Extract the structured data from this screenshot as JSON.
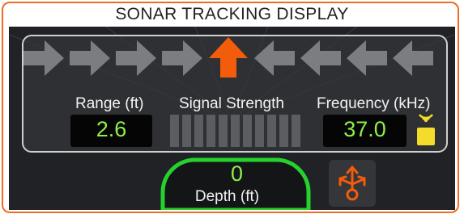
{
  "title": "SONAR TRACKING DISPLAY",
  "colors": {
    "frame": "#ef6c22",
    "accent": "#f25c0a",
    "arrow_inactive": "#7b7d80",
    "value_text": "#8df04a",
    "depth_ring": "#25d12d",
    "signal_icon": "#f5dc2a",
    "signal_bar_off": "#5b5d61"
  },
  "direction_arrows": {
    "items": [
      {
        "direction": "right",
        "active": false
      },
      {
        "direction": "right",
        "active": false
      },
      {
        "direction": "right",
        "active": false
      },
      {
        "direction": "right",
        "active": false
      },
      {
        "direction": "up",
        "active": true
      },
      {
        "direction": "left",
        "active": false
      },
      {
        "direction": "left",
        "active": false
      },
      {
        "direction": "left",
        "active": false
      },
      {
        "direction": "left",
        "active": false
      }
    ]
  },
  "range": {
    "label": "Range (ft)",
    "value": "2.6"
  },
  "signal_strength": {
    "label": "Signal Strength",
    "bar_count": 11,
    "active_bars": 0
  },
  "frequency": {
    "label": "Frequency (kHz)",
    "value": "37.0",
    "icon": "signal-wave-icon"
  },
  "depth": {
    "label": "Depth (ft)",
    "value": "0"
  },
  "action_button": {
    "icon": "transducer-icon"
  }
}
